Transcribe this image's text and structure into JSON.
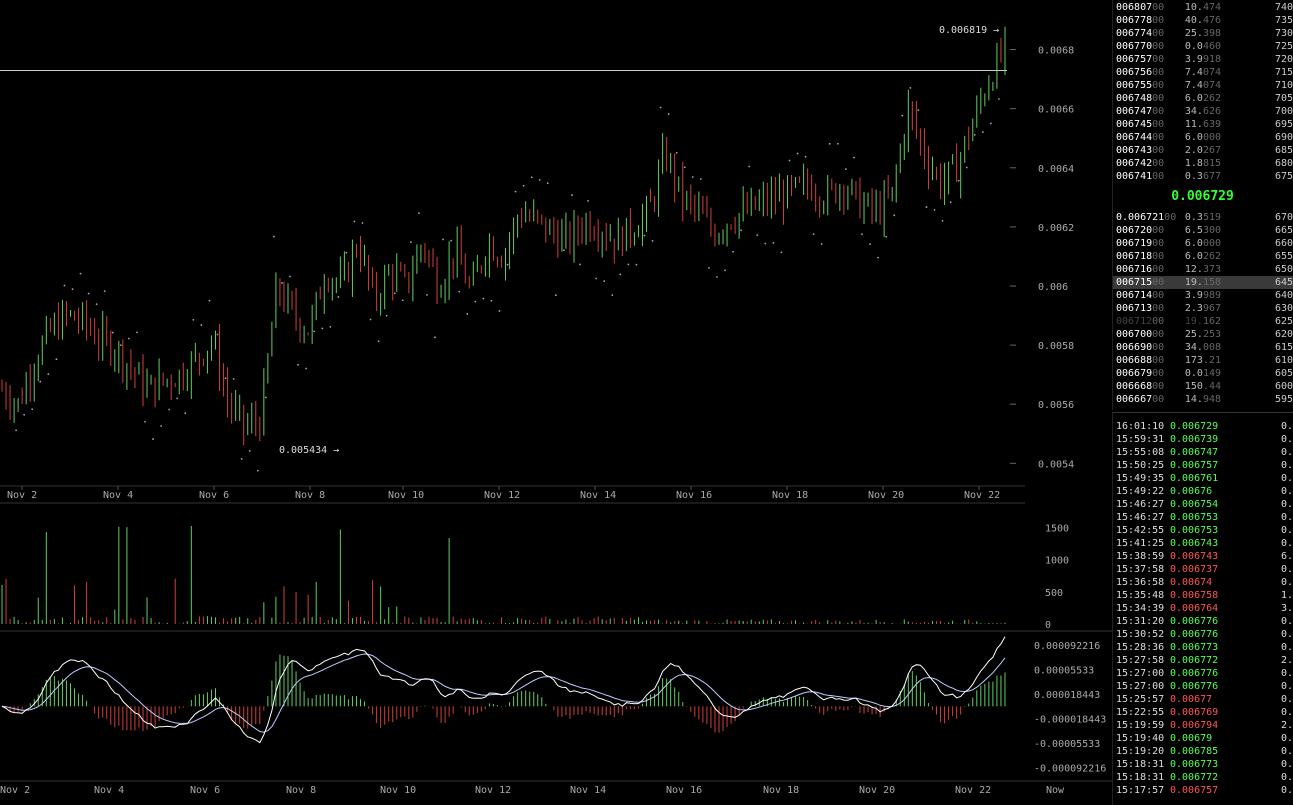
{
  "chart_data": [
    {
      "type": "candlestick",
      "name": "price",
      "xlabels": [
        "Nov 2",
        "Nov 4",
        "Nov 6",
        "Nov 8",
        "Nov 10",
        "Nov 12",
        "Nov 14",
        "Nov 16",
        "Nov 18",
        "Nov 20",
        "Nov 22"
      ],
      "ylim": [
        0.00533,
        0.0069
      ],
      "yticks": [
        "0.0068",
        "0.0066",
        "0.0064",
        "0.0062",
        "0.006",
        "0.0058",
        "0.0056",
        "0.0054"
      ],
      "ytick_values": [
        0.0068,
        0.0066,
        0.0064,
        0.0062,
        0.006,
        0.0058,
        0.0056,
        0.0054
      ],
      "high_marker": "0.006819 →",
      "low_marker": "0.005434 →",
      "high_value": 0.006819,
      "low_value": 0.005434,
      "reference_line": 0.006729,
      "trend": [
        0.00565,
        0.0056,
        0.00575,
        0.00585,
        0.0059,
        0.00588,
        0.00582,
        0.00579,
        0.00572,
        0.00565,
        0.00568,
        0.0057,
        0.00575,
        0.00582,
        0.0056,
        0.00552,
        0.00555,
        0.006,
        0.0059,
        0.00585,
        0.00605,
        0.006,
        0.00615,
        0.00595,
        0.00605,
        0.006,
        0.00615,
        0.006,
        0.00612,
        0.00598,
        0.00615,
        0.0061,
        0.00625,
        0.00622,
        0.00618,
        0.00615,
        0.00622,
        0.0062,
        0.00615,
        0.0062,
        0.00625,
        0.00645,
        0.0063,
        0.00625,
        0.00618,
        0.00623,
        0.00625,
        0.00628,
        0.0063,
        0.00632,
        0.00634,
        0.0063,
        0.00635,
        0.00628,
        0.00625,
        0.0063,
        0.0066,
        0.00645,
        0.00635,
        0.0064,
        0.00655,
        0.0067,
        0.0068
      ]
    },
    {
      "type": "bar",
      "name": "volume",
      "ylim": [
        0,
        1800
      ],
      "yticks": [
        "1500",
        "1000",
        "500",
        "0"
      ],
      "ytick_values": [
        1500,
        1000,
        500,
        0
      ]
    },
    {
      "type": "macd",
      "name": "macd",
      "ylim": [
        -0.000105,
        0.0001
      ],
      "yticks": [
        "0.000092216",
        "0.00005533",
        "0.000018443",
        "-0.000018443",
        "-0.00005533",
        "-0.000092216"
      ],
      "ytick_values": [
        9.2216e-05,
        5.533e-05,
        1.8443e-05,
        -1.8443e-05,
        -5.533e-05,
        -9.2216e-05
      ],
      "xlabels": [
        "Nov 2",
        "Nov 4",
        "Nov 6",
        "Nov 8",
        "Nov 10",
        "Nov 12",
        "Nov 14",
        "Nov 16",
        "Nov 18",
        "Nov 20",
        "Nov 22",
        "Now"
      ]
    }
  ],
  "orderbook": {
    "asks": [
      {
        "price": "006807",
        "trail": "00",
        "size_main": "10.",
        "size_trail": "474",
        "sum": "740"
      },
      {
        "price": "006778",
        "trail": "00",
        "size_main": "40.",
        "size_trail": "476",
        "sum": "735"
      },
      {
        "price": "006774",
        "trail": "00",
        "size_main": "25.",
        "size_trail": "398",
        "sum": "730"
      },
      {
        "price": "006770",
        "trail": "00",
        "size_main": "0.0",
        "size_trail": "460",
        "sum": "725"
      },
      {
        "price": "006757",
        "trail": "00",
        "size_main": "3.9",
        "size_trail": "918",
        "sum": "720"
      },
      {
        "price": "006756",
        "trail": "00",
        "size_main": "7.4",
        "size_trail": "074",
        "sum": "715"
      },
      {
        "price": "006755",
        "trail": "00",
        "size_main": "7.4",
        "size_trail": "074",
        "sum": "710"
      },
      {
        "price": "006748",
        "trail": "00",
        "size_main": "6.0",
        "size_trail": "262",
        "sum": "705"
      },
      {
        "price": "006747",
        "trail": "00",
        "size_main": "34.",
        "size_trail": "626",
        "sum": "700"
      },
      {
        "price": "006745",
        "trail": "00",
        "size_main": "11.",
        "size_trail": "639",
        "sum": "695"
      },
      {
        "price": "006744",
        "trail": "00",
        "size_main": "6.0",
        "size_trail": "000",
        "sum": "690"
      },
      {
        "price": "006743",
        "trail": "00",
        "size_main": "2.0",
        "size_trail": "267",
        "sum": "685"
      },
      {
        "price": "006742",
        "trail": "00",
        "size_main": "1.8",
        "size_trail": "815",
        "sum": "680"
      },
      {
        "price": "006741",
        "trail": "00",
        "size_main": "0.3",
        "size_trail": "677",
        "sum": "675"
      }
    ],
    "last": "0.006729",
    "bids": [
      {
        "price": "0.006721",
        "trail": "00",
        "size_main": "0.3",
        "size_trail": "519",
        "sum": "670"
      },
      {
        "price": "006720",
        "trail": "00",
        "size_main": "6.5",
        "size_trail": "300",
        "sum": "665"
      },
      {
        "price": "006719",
        "trail": "00",
        "size_main": "6.0",
        "size_trail": "000",
        "sum": "660"
      },
      {
        "price": "006718",
        "trail": "00",
        "size_main": "6.0",
        "size_trail": "262",
        "sum": "655"
      },
      {
        "price": "006716",
        "trail": "00",
        "size_main": "12.",
        "size_trail": "373",
        "sum": "650"
      },
      {
        "price": "006715",
        "trail": "00",
        "size_main": "19.",
        "size_trail": "158",
        "sum": "645",
        "highlight": true
      },
      {
        "price": "006714",
        "trail": "00",
        "size_main": "3.9",
        "size_trail": "989",
        "sum": "640"
      },
      {
        "price": "006713",
        "trail": "00",
        "size_main": "2.3",
        "size_trail": "967",
        "sum": "630"
      },
      {
        "price": "006712",
        "trail": "00",
        "size_main": "19.",
        "size_trail": "162",
        "sum": "625",
        "dim": true
      },
      {
        "price": "006700",
        "trail": "00",
        "size_main": "25.",
        "size_trail": "253",
        "sum": "620"
      },
      {
        "price": "006690",
        "trail": "00",
        "size_main": "34.",
        "size_trail": "008",
        "sum": "615"
      },
      {
        "price": "006688",
        "trail": "00",
        "size_main": "173",
        "size_trail": ".21",
        "sum": "610"
      },
      {
        "price": "006679",
        "trail": "00",
        "size_main": "0.0",
        "size_trail": "149",
        "sum": "605"
      },
      {
        "price": "006668",
        "trail": "00",
        "size_main": "150",
        "size_trail": ".44",
        "sum": "600"
      },
      {
        "price": "006667",
        "trail": "00",
        "size_main": "14.",
        "size_trail": "948",
        "sum": "595"
      }
    ]
  },
  "trades": [
    {
      "time": "16:01:10",
      "price": "0.006729",
      "side": "buy",
      "size": "0."
    },
    {
      "time": "15:59:31",
      "price": "0.006739",
      "side": "buy",
      "size": "0."
    },
    {
      "time": "15:55:08",
      "price": "0.006747",
      "side": "buy",
      "size": "0."
    },
    {
      "time": "15:50:25",
      "price": "0.006757",
      "side": "buy",
      "size": "0."
    },
    {
      "time": "15:49:35",
      "price": "0.006761",
      "side": "buy",
      "size": "0."
    },
    {
      "time": "15:49:22",
      "price": "0.00676",
      "side": "buy",
      "size": "0."
    },
    {
      "time": "15:46:27",
      "price": "0.006754",
      "side": "buy",
      "size": "0."
    },
    {
      "time": "15:46:27",
      "price": "0.006753",
      "side": "buy",
      "size": "0."
    },
    {
      "time": "15:42:55",
      "price": "0.006753",
      "side": "buy",
      "size": "0."
    },
    {
      "time": "15:41:25",
      "price": "0.006743",
      "side": "buy",
      "size": "0."
    },
    {
      "time": "15:38:59",
      "price": "0.006743",
      "side": "sell",
      "size": "6."
    },
    {
      "time": "15:37:58",
      "price": "0.006737",
      "side": "sell",
      "size": "0."
    },
    {
      "time": "15:36:58",
      "price": "0.00674",
      "side": "sell",
      "size": "0."
    },
    {
      "time": "15:35:48",
      "price": "0.006758",
      "side": "sell",
      "size": "1."
    },
    {
      "time": "15:34:39",
      "price": "0.006764",
      "side": "sell",
      "size": "3."
    },
    {
      "time": "15:31:20",
      "price": "0.006776",
      "side": "buy",
      "size": "0."
    },
    {
      "time": "15:30:52",
      "price": "0.006776",
      "side": "buy",
      "size": "0."
    },
    {
      "time": "15:28:36",
      "price": "0.006773",
      "side": "buy",
      "size": "0."
    },
    {
      "time": "15:27:58",
      "price": "0.006772",
      "side": "buy",
      "size": "2."
    },
    {
      "time": "15:27:00",
      "price": "0.006776",
      "side": "buy",
      "size": "0."
    },
    {
      "time": "15:27:00",
      "price": "0.006776",
      "side": "buy",
      "size": "0."
    },
    {
      "time": "15:25:57",
      "price": "0.00677",
      "side": "sell",
      "size": "0."
    },
    {
      "time": "15:22:55",
      "price": "0.006769",
      "side": "sell",
      "size": "0."
    },
    {
      "time": "15:19:59",
      "price": "0.006794",
      "side": "sell",
      "size": "2."
    },
    {
      "time": "15:19:40",
      "price": "0.00679",
      "side": "buy",
      "size": "0."
    },
    {
      "time": "15:19:20",
      "price": "0.006785",
      "side": "buy",
      "size": "0."
    },
    {
      "time": "15:18:31",
      "price": "0.006773",
      "side": "buy",
      "size": "0."
    },
    {
      "time": "15:18:31",
      "price": "0.006772",
      "side": "buy",
      "size": "0."
    },
    {
      "time": "15:17:57",
      "price": "0.006757",
      "side": "sell",
      "size": "0."
    }
  ],
  "colors": {
    "up": "#5fcf5f",
    "down": "#cf3f3f",
    "grid_text": "#aaaaaa",
    "sar_dots": "#9ab",
    "macd_line": "#ffffff",
    "signal_line": "#bbccff"
  }
}
